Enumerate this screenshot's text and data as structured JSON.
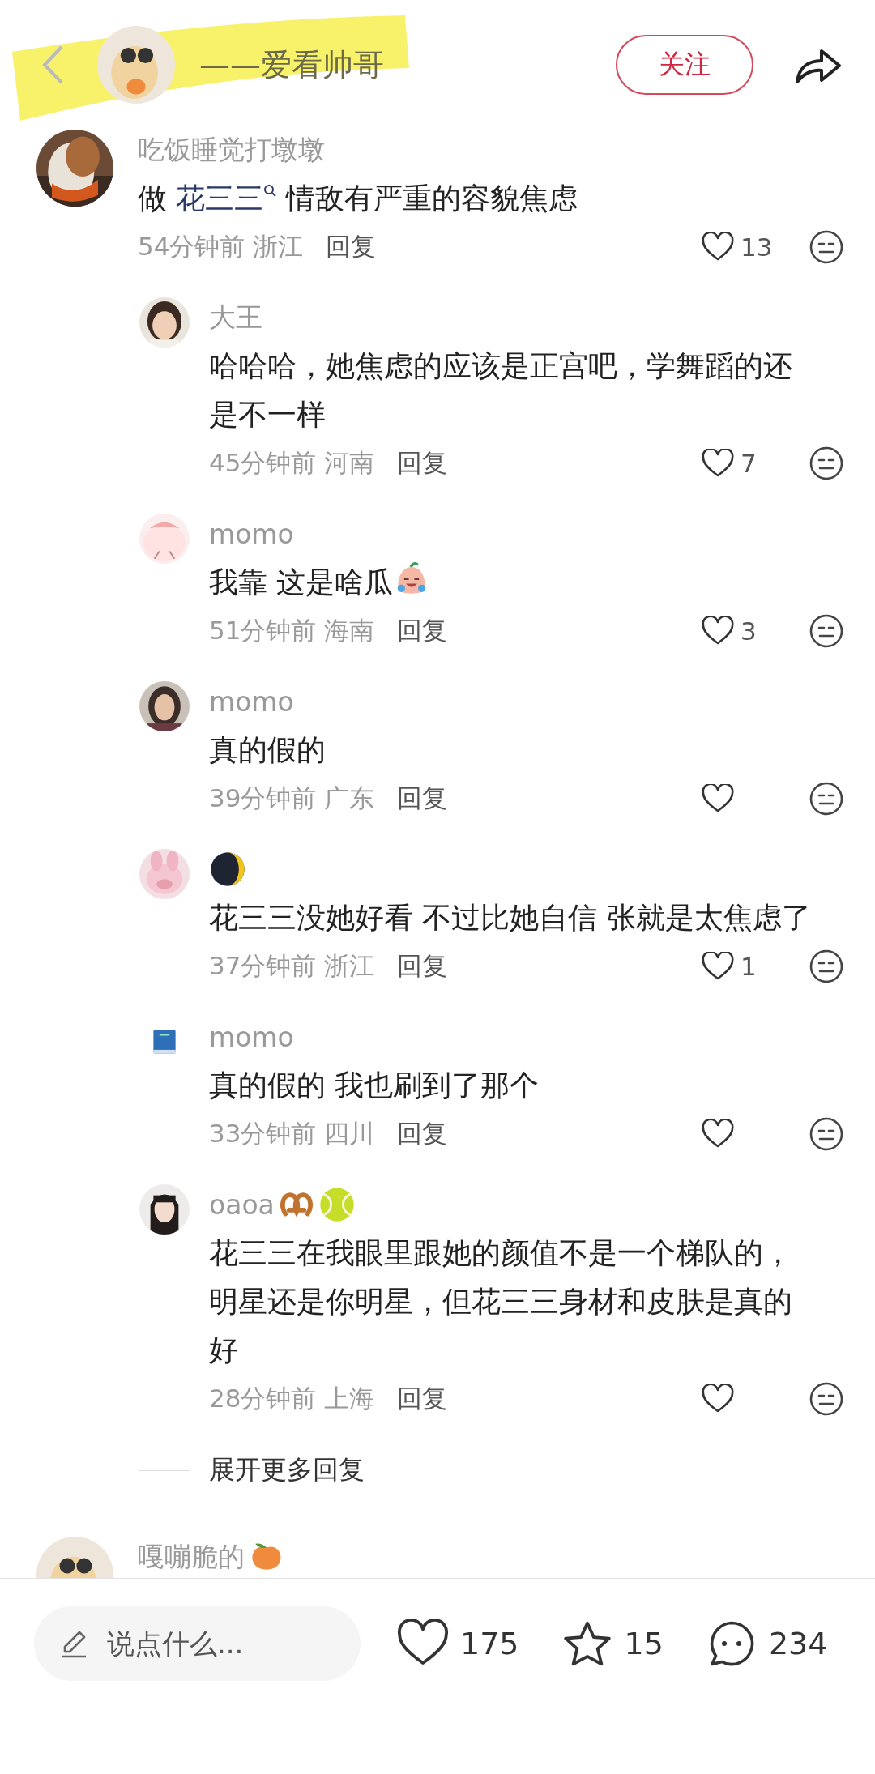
{
  "header": {
    "author": "——爱看帅哥",
    "follow_button": "关注"
  },
  "comments": [
    {
      "kind": "top",
      "username": "吃饭睡觉打墩墩",
      "text_before": "做",
      "search_link": "花三三",
      "text_after": "情敌有严重的容貌焦虑",
      "meta": "54分钟前 浙江",
      "reply": "回复",
      "likes": "13"
    },
    {
      "kind": "reply",
      "username": "大王",
      "text": "哈哈哈，她焦虑的应该是正宫吧，学舞蹈的还是不一样",
      "meta": "45分钟前 河南",
      "reply": "回复",
      "likes": "7"
    },
    {
      "kind": "reply",
      "username": "momo",
      "text": "我靠 这是啥瓜",
      "text_icons": [
        {
          "kind": "crying"
        }
      ],
      "meta": "51分钟前 海南",
      "reply": "回复",
      "likes": "3"
    },
    {
      "kind": "reply",
      "username": "momo",
      "text": "真的假的",
      "meta": "39分钟前 广东",
      "reply": "回复"
    },
    {
      "kind": "reply",
      "name_icons": [
        {
          "kind": "moon"
        }
      ],
      "text": "花三三没她好看 不过比她自信 张就是太焦虑了",
      "meta": "37分钟前 浙江",
      "reply": "回复",
      "likes": "1"
    },
    {
      "kind": "reply",
      "username": "momo",
      "text": "真的假的 我也刷到了那个",
      "meta": "33分钟前 四川",
      "reply": "回复"
    },
    {
      "kind": "reply",
      "username": "oaoa",
      "name_icons": [
        {
          "kind": "pretzel"
        },
        {
          "kind": "ball"
        }
      ],
      "text": "花三三在我眼里跟她的颜值不是一个梯队的，明星还是你明星，但花三三身材和皮肤是真的好",
      "meta": "28分钟前 上海",
      "reply": "回复"
    },
    {
      "kind": "more",
      "text": "展开更多回复"
    },
    {
      "kind": "top",
      "username": "嘎嘣脆的",
      "name_icons": [
        {
          "kind": "peach"
        }
      ]
    }
  ],
  "bottom_bar": {
    "placeholder": "说点什么...",
    "likes": "175",
    "stars": "15",
    "comments": "234"
  }
}
